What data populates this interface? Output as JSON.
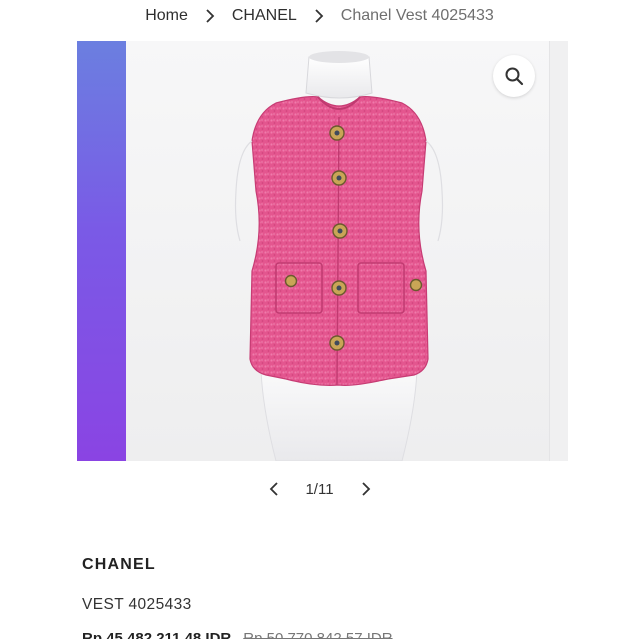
{
  "breadcrumb": {
    "items": [
      "Home",
      "CHANEL",
      "Chanel Vest 4025433"
    ]
  },
  "gallery": {
    "image_subject": "pink tweed sleeveless vest on mannequin",
    "zoom_icon": "search-icon",
    "colors": {
      "vest": "#e75b96",
      "strip_top": "#6b7fe0",
      "strip_bottom": "#8a44e3"
    }
  },
  "pager": {
    "prev_icon": "chevron-left-icon",
    "count": "1/11",
    "next_icon": "chevron-right-icon"
  },
  "product": {
    "brand": "CHANEL",
    "name": "VEST 4025433",
    "price": "Rp 45.482.211,48 IDR",
    "original_price": "Rp 50.770.842,57 IDR"
  }
}
